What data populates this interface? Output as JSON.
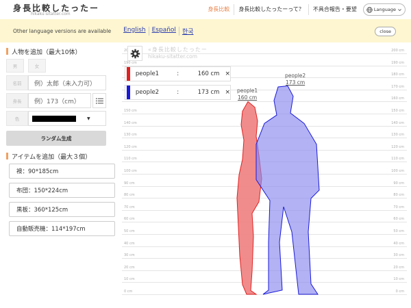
{
  "header": {
    "logo_title": "身長比較したったー",
    "logo_sub": "hikaku-sitatter.com",
    "nav": [
      "身長比較",
      "身長比較したったーって？",
      "不具合報告・要望"
    ],
    "language_button": "Language"
  },
  "notice": {
    "text": "Other language versions are available",
    "links": [
      "English",
      "Español",
      "한국"
    ],
    "close_label": "close"
  },
  "sidebar": {
    "add_person_title": "人物を追加（最大10体）",
    "gender": [
      "男",
      "女"
    ],
    "name_label": "名前",
    "name_placeholder": "例）太郎（未入力可）",
    "height_label": "身長",
    "height_placeholder": "例）173（cm）",
    "color_label": "色",
    "color_value": "#000000",
    "random_button": "ランダム生成",
    "add_item_title": "アイテムを追加（最大３個）",
    "items": [
      "襖：90*185cm",
      "布団：150*224cm",
      "黒板：360*125cm",
      "自動販売機：114*197cm"
    ]
  },
  "chart": {
    "watermark_title": "«身長比較したったー",
    "watermark_sub": "hikaku-sitatter.com",
    "ticks": [
      "200 cm",
      "190 cm",
      "180 cm",
      "170 cm",
      "160 cm",
      "150 cm",
      "140 cm",
      "130 cm",
      "120 cm",
      "110 cm",
      "100 cm",
      "90 cm",
      "80 cm",
      "70 cm",
      "60 cm",
      "50 cm",
      "40 cm",
      "30 cm",
      "20 cm",
      "10 cm",
      "0 cm"
    ],
    "legend": [
      {
        "name": "people1",
        "colon": ":",
        "height": "160 cm",
        "color": "#e02020",
        "remove": "×"
      },
      {
        "name": "people2",
        "colon": ":",
        "height": "173 cm",
        "color": "#1a1ad8",
        "remove": "×"
      }
    ],
    "figures": [
      {
        "name": "people1",
        "height_label": "160 cm",
        "fill": "#f08080",
        "stroke": "#e02020"
      },
      {
        "name": "people2",
        "height_label": "173 cm",
        "fill": "#8888ee",
        "stroke": "#1a1ad8"
      }
    ]
  },
  "chart_data": {
    "type": "bar",
    "categories": [
      "people1",
      "people2"
    ],
    "values": [
      160,
      173
    ],
    "ylabel": "cm",
    "ylim": [
      0,
      200
    ]
  }
}
